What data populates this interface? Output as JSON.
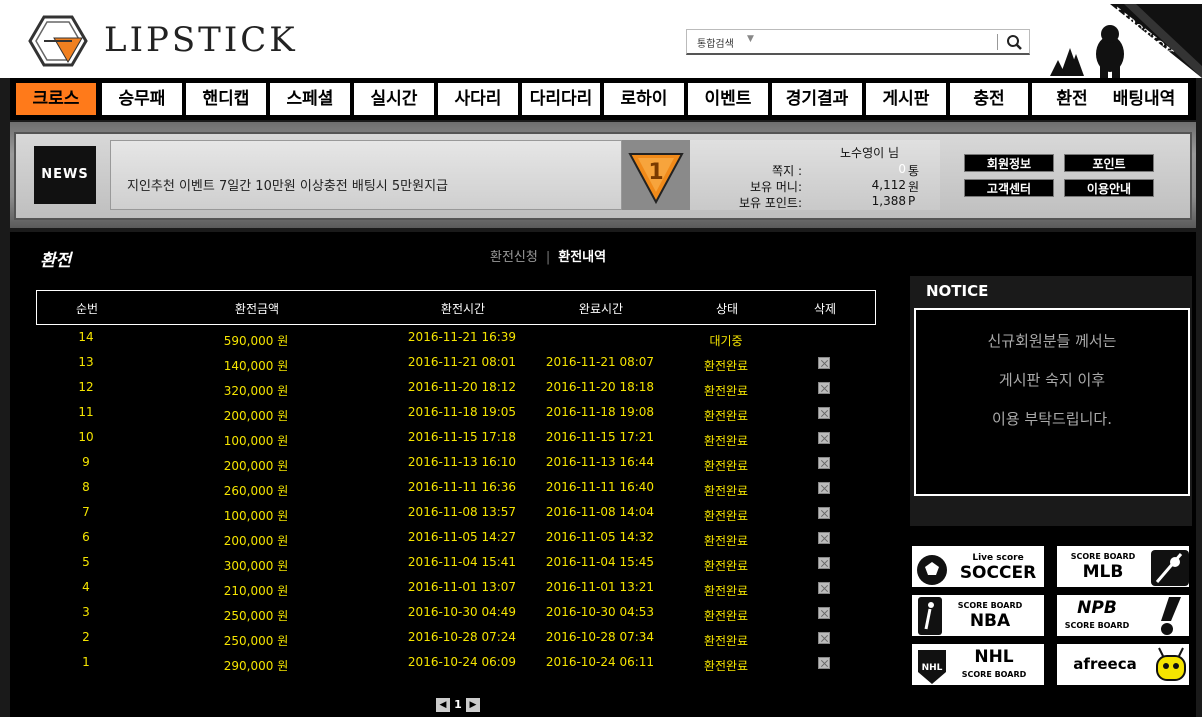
{
  "brand": {
    "name": "LIPSTICK",
    "corner_label": "LIPSTICK"
  },
  "search": {
    "scope": "통합검색",
    "placeholder": ""
  },
  "nav": [
    "크로스",
    "승무패",
    "핸디캡",
    "스페셜",
    "실시간",
    "사다리",
    "다리다리",
    "로하이",
    "이벤트",
    "경기결과",
    "게시판",
    "충전",
    "환전",
    "배팅내역"
  ],
  "news": {
    "tag": "NEWS",
    "text": "지인추천 이벤트 7일간 10만원 이상충전 배팅시 5만원지급"
  },
  "level": "1",
  "user": {
    "name": "노수영이 님",
    "msg_label": "쪽지 :",
    "msg_count": "0",
    "msg_unit": "통",
    "money_label": "보유 머니:",
    "money": "4,112",
    "money_unit": "원",
    "point_label": "보유 포인트:",
    "point": "1,388",
    "point_unit": "P"
  },
  "side_buttons": [
    "회원정보",
    "포인트",
    "고객센터",
    "이용안내"
  ],
  "page": {
    "title": "환전",
    "tab_request": "환전신청",
    "tab_history": "환전내역"
  },
  "table": {
    "headers": [
      "순번",
      "환전금액",
      "환전시간",
      "완료시간",
      "상태",
      "삭제"
    ],
    "rows": [
      {
        "no": "14",
        "amount": "590,000 원",
        "time": "2016-11-21 16:39",
        "done": "",
        "status": "대기중",
        "del": false
      },
      {
        "no": "13",
        "amount": "140,000 원",
        "time": "2016-11-21 08:01",
        "done": "2016-11-21 08:07",
        "status": "환전완료",
        "del": true
      },
      {
        "no": "12",
        "amount": "320,000 원",
        "time": "2016-11-20 18:12",
        "done": "2016-11-20 18:18",
        "status": "환전완료",
        "del": true
      },
      {
        "no": "11",
        "amount": "200,000 원",
        "time": "2016-11-18 19:05",
        "done": "2016-11-18 19:08",
        "status": "환전완료",
        "del": true
      },
      {
        "no": "10",
        "amount": "100,000 원",
        "time": "2016-11-15 17:18",
        "done": "2016-11-15 17:21",
        "status": "환전완료",
        "del": true
      },
      {
        "no": "9",
        "amount": "200,000 원",
        "time": "2016-11-13 16:10",
        "done": "2016-11-13 16:44",
        "status": "환전완료",
        "del": true
      },
      {
        "no": "8",
        "amount": "260,000 원",
        "time": "2016-11-11 16:36",
        "done": "2016-11-11 16:40",
        "status": "환전완료",
        "del": true
      },
      {
        "no": "7",
        "amount": "100,000 원",
        "time": "2016-11-08 13:57",
        "done": "2016-11-08 14:04",
        "status": "환전완료",
        "del": true
      },
      {
        "no": "6",
        "amount": "200,000 원",
        "time": "2016-11-05 14:27",
        "done": "2016-11-05 14:32",
        "status": "환전완료",
        "del": true
      },
      {
        "no": "5",
        "amount": "300,000 원",
        "time": "2016-11-04 15:41",
        "done": "2016-11-04 15:45",
        "status": "환전완료",
        "del": true
      },
      {
        "no": "4",
        "amount": "210,000 원",
        "time": "2016-11-01 13:07",
        "done": "2016-11-01 13:21",
        "status": "환전완료",
        "del": true
      },
      {
        "no": "3",
        "amount": "250,000 원",
        "time": "2016-10-30 04:49",
        "done": "2016-10-30 04:53",
        "status": "환전완료",
        "del": true
      },
      {
        "no": "2",
        "amount": "250,000 원",
        "time": "2016-10-28 07:24",
        "done": "2016-10-28 07:34",
        "status": "환전완료",
        "del": true
      },
      {
        "no": "1",
        "amount": "290,000 원",
        "time": "2016-10-24 06:09",
        "done": "2016-10-24 06:11",
        "status": "환전완료",
        "del": true
      }
    ]
  },
  "pager": {
    "current": "1"
  },
  "notice": {
    "title": "NOTICE",
    "lines": [
      "신규회원분들 께서는",
      "게시판 숙지 이후",
      "이용 부탁드립니다."
    ]
  },
  "score_links": [
    {
      "small": "Live score",
      "big": "SOCCER",
      "icon": "soccer-ball-icon"
    },
    {
      "small": "SCORE BOARD",
      "big": "MLB",
      "icon": "mlb-logo-icon"
    },
    {
      "small": "SCORE BOARD",
      "big": "NBA",
      "icon": "nba-logo-icon"
    },
    {
      "small": "SCORE BOARD",
      "big": "NPB",
      "icon": "npb-logo-icon"
    },
    {
      "small": "SCORE BOARD",
      "big": "NHL",
      "icon": "nhl-logo-icon"
    },
    {
      "small": "",
      "big": "afreeca",
      "icon": "afreeca-logo-icon"
    }
  ],
  "colors": {
    "accent": "#ff7a1a",
    "table_text": "#f5e400",
    "background": "#000000"
  }
}
